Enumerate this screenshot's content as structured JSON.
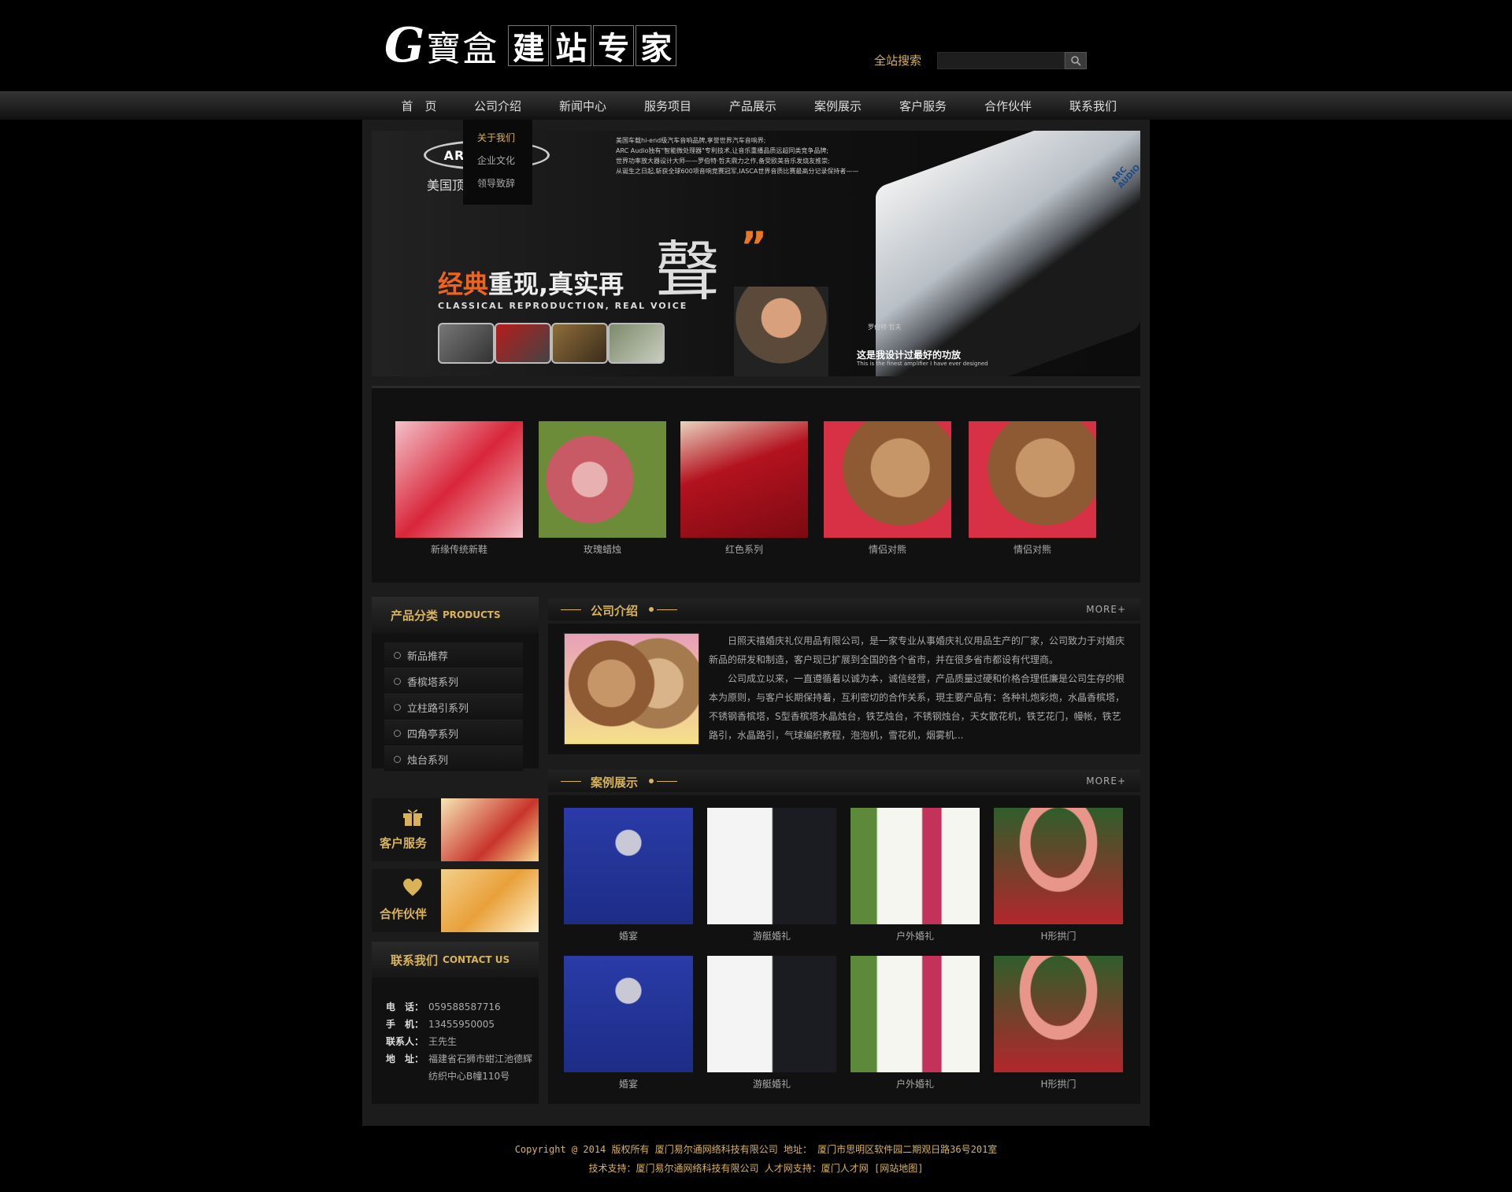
{
  "header": {
    "logo_letter": "G",
    "logo_seal": "寶盒",
    "logo_tiles": [
      "建",
      "站",
      "专",
      "家"
    ],
    "search_label": "全站搜索",
    "search_placeholder": ""
  },
  "nav": [
    "首　页",
    "公司介绍",
    "新闻中心",
    "服务项目",
    "产品展示",
    "案例展示",
    "客户服务",
    "合作伙伴",
    "联系我们"
  ],
  "submenu": [
    "关于我们",
    "企业文化",
    "领导致辞"
  ],
  "banner": {
    "logo": "ARC AUDIO",
    "tagline": "美国顶级汽车音响",
    "text_lines": [
      "美国车载hi-end级汽车音响品牌,享誉世界汽车音响界;",
      "ARC Audio独有\"智能微处理器\"专利技术,让音乐重播品质远超同类竞争品牌;",
      "世界功率放大器设计大师——罗伯特·哲夫鼎力之作,备受欧美音乐发烧友推崇;",
      "从诞生之日起,斩获全球600项音响竞赛冠军,IASCA世界音质比赛最高分记录保持者——"
    ],
    "headline_accent": "经典",
    "headline_rest": "重现,真实再",
    "big_char": "聲",
    "quote": "”",
    "subline": "CLASSICAL  REPRODUCTION,  REAL  VOICE",
    "signature": "罗伯特·哲夫",
    "caption": "这是我设计过最好的功放",
    "caption_en": "This is the finest amplifier I have ever designed",
    "amp_label": "ARC AUDIO"
  },
  "gallery": [
    {
      "caption": "新缘传统新鞋",
      "c1": "#d9263a",
      "c2": "#f3c1c8"
    },
    {
      "caption": "玫瑰蜡烛",
      "c1": "#c75a64",
      "c2": "#6c8c3a"
    },
    {
      "caption": "红色系列",
      "c1": "#b3121e",
      "c2": "#e9d3c0"
    },
    {
      "caption": "情侣对熊",
      "c1": "#8e5a34",
      "c2": "#d83044"
    },
    {
      "caption": "情侣对熊",
      "c1": "#8e5a34",
      "c2": "#d83044"
    }
  ],
  "products": {
    "title": "产品分类",
    "title_en": "PRODUCTS",
    "items": [
      "新品推荐",
      "香槟塔系列",
      "立柱路引系列",
      "四角亭系列",
      "烛台系列"
    ]
  },
  "promos": [
    {
      "label": "客户服务",
      "icon": "gift-icon",
      "glyph": "🎁"
    },
    {
      "label": "合作伙伴",
      "icon": "heart-icon",
      "glyph": "♥"
    }
  ],
  "contact": {
    "title": "联系我们",
    "title_en": "CONTACT US",
    "rows": [
      {
        "key": "电　话：",
        "value": "059588587716"
      },
      {
        "key": "手　机：",
        "value": "13455950005"
      },
      {
        "key": "联系人：",
        "value": "王先生"
      },
      {
        "key": "地　址：",
        "value": "福建省石狮市蚶江池德辉"
      },
      {
        "key": "",
        "value": "纺织中心B幢110号"
      }
    ]
  },
  "intro": {
    "title": "公司介绍",
    "more": "MORE+",
    "paragraphs": [
      "日照天禧婚庆礼仪用品有限公司，是一家专业从事婚庆礼仪用品生产的厂家，公司致力于对婚庆新品的研发和制造，客户现已扩展到全国的各个省市，并在很多省市都设有代理商。",
      "公司成立以来，一直遵循着以诚为本，诚信经营，产品质量过硬和价格合理低廉是公司生存的根本为原则，与客户长期保持着，互利密切的合作关系，現主要产品有：各种礼炮彩炮，水晶香槟塔，不锈钢香槟塔，S型香槟塔水晶烛台，铁艺烛台，不锈钢烛台，天女散花机，铁艺花门，幔帐，铁艺路引，水晶路引，气球编织教程，泡泡机，雪花机，烟雾机..."
    ]
  },
  "cases": {
    "title": "案例展示",
    "more": "MORE+",
    "items": [
      {
        "caption": "婚宴",
        "c1": "#1d2c86",
        "c2": "#c9c9d6"
      },
      {
        "caption": "游艇婚礼",
        "c1": "#f4f4f4",
        "c2": "#1b1b22"
      },
      {
        "caption": "户外婚礼",
        "c1": "#f6f6f0",
        "c2": "#c2325a"
      },
      {
        "caption": "H形拱门",
        "c1": "#e8958a",
        "c2": "#2f5e2a"
      },
      {
        "caption": "婚宴",
        "c1": "#1d2c86",
        "c2": "#c9c9d6"
      },
      {
        "caption": "游艇婚礼",
        "c1": "#f4f4f4",
        "c2": "#1b1b22"
      },
      {
        "caption": "户外婚礼",
        "c1": "#f6f6f0",
        "c2": "#c2325a"
      },
      {
        "caption": "H形拱门",
        "c1": "#e8958a",
        "c2": "#2f5e2a"
      }
    ]
  },
  "footer": {
    "line1": "Copyright @ 2014 版权所有 厦门易尔通网络科技有限公司 地址： 厦门市思明区软件园二期观日路36号201室",
    "line2": "技术支持：厦门易尔通网络科技有限公司 人才网支持：厦门人才网 [网站地图]"
  },
  "colors": {
    "accent": "#d8b35a",
    "background": "#000000",
    "panel": "#1c1c1c"
  }
}
